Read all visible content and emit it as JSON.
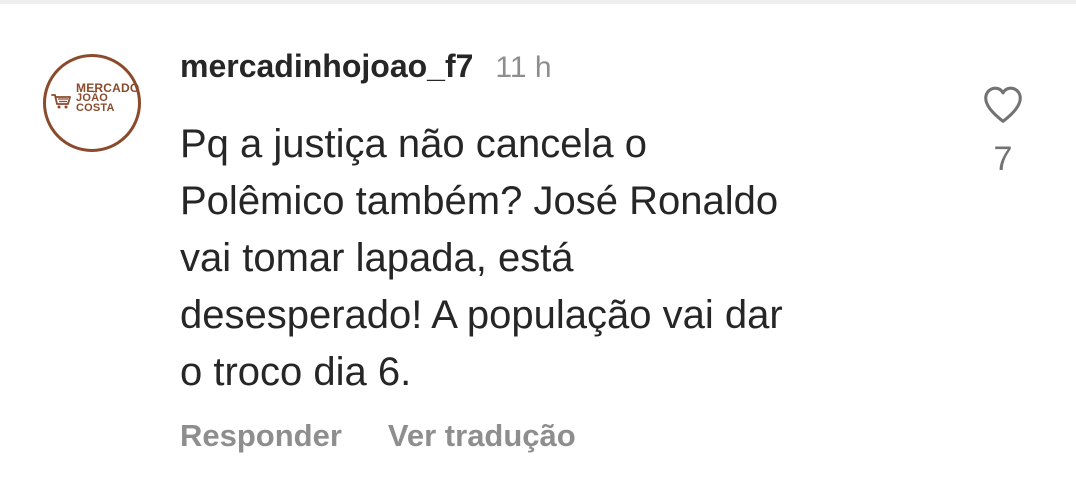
{
  "comment": {
    "avatar": {
      "text_lines": [
        "MERCADO",
        "JOÃO",
        "COSTA"
      ],
      "icon": "shopping-cart-icon",
      "border_color": "#8a4a2b"
    },
    "username": "mercadinhojoao_f7",
    "time": "11 h",
    "text": "Pq a justiça não cancela o\nPolêmico também? José Ronaldo\nvai tomar lapada, está\ndesesperado! A população vai dar\no troco dia 6.",
    "actions": {
      "reply": "Responder",
      "translate": "Ver tradução"
    },
    "like": {
      "icon": "heart-outline-icon",
      "count": "7"
    }
  },
  "colors": {
    "text": "#262626",
    "secondary": "#8e8e8e",
    "like_count": "#737373"
  }
}
